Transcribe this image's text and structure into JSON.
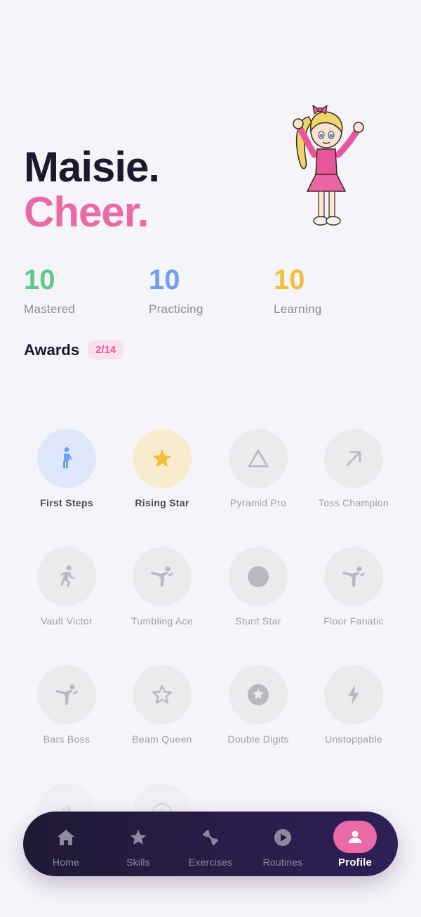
{
  "profile": {
    "name": "Maisie.",
    "sport": "Cheer."
  },
  "stats": [
    {
      "value": "10",
      "label": "Mastered",
      "color": "#5cc98a"
    },
    {
      "value": "10",
      "label": "Practicing",
      "color": "#6f9ff0"
    },
    {
      "value": "10",
      "label": "Learning",
      "color": "#f3bd3c"
    }
  ],
  "awards": {
    "title": "Awards",
    "count": "2/14",
    "items": [
      {
        "label": "First Steps",
        "icon": "walking-person-icon",
        "earned": true
      },
      {
        "label": "Rising Star",
        "icon": "star-icon",
        "earned": true
      },
      {
        "label": "Pyramid Pro",
        "icon": "triangle-icon",
        "earned": false
      },
      {
        "label": "Toss Champion",
        "icon": "arrow-up-right-icon",
        "earned": false
      },
      {
        "label": "Vault Victor",
        "icon": "running-person-icon",
        "earned": false
      },
      {
        "label": "Tumbling Ace",
        "icon": "martial-arts-kick-icon",
        "earned": false
      },
      {
        "label": "Stunt Star",
        "icon": "filled-circle-icon",
        "earned": false
      },
      {
        "label": "Floor Fanatic",
        "icon": "martial-arts-kick-icon",
        "earned": false
      },
      {
        "label": "Bars Boss",
        "icon": "martial-arts-kick-icon",
        "earned": false
      },
      {
        "label": "Beam Queen",
        "icon": "star-outline-icon",
        "earned": false
      },
      {
        "label": "Double Digits",
        "icon": "star-circle-icon",
        "earned": false
      },
      {
        "label": "Unstoppable",
        "icon": "lightning-bolt-icon",
        "earned": false
      },
      {
        "label": "",
        "icon": "flame-icon",
        "earned": false
      },
      {
        "label": "",
        "icon": "star-badge-icon",
        "earned": false
      }
    ]
  },
  "nav": {
    "tabs": [
      {
        "label": "Home",
        "icon": "home-icon",
        "active": false
      },
      {
        "label": "Skills",
        "icon": "star-icon",
        "active": false
      },
      {
        "label": "Exercises",
        "icon": "dumbbell-icon",
        "active": false
      },
      {
        "label": "Routines",
        "icon": "play-circle-icon",
        "active": false
      },
      {
        "label": "Profile",
        "icon": "person-icon",
        "active": true
      }
    ]
  },
  "colors": {
    "accent": "#ea6aa8",
    "earned_first_steps_bg": "#dfe8fa",
    "earned_first_steps_fg": "#6f9ff0",
    "earned_rising_star_bg": "#f9ebcd",
    "earned_rising_star_fg": "#f3bd3c",
    "locked_icon": "#b8b8bf"
  }
}
